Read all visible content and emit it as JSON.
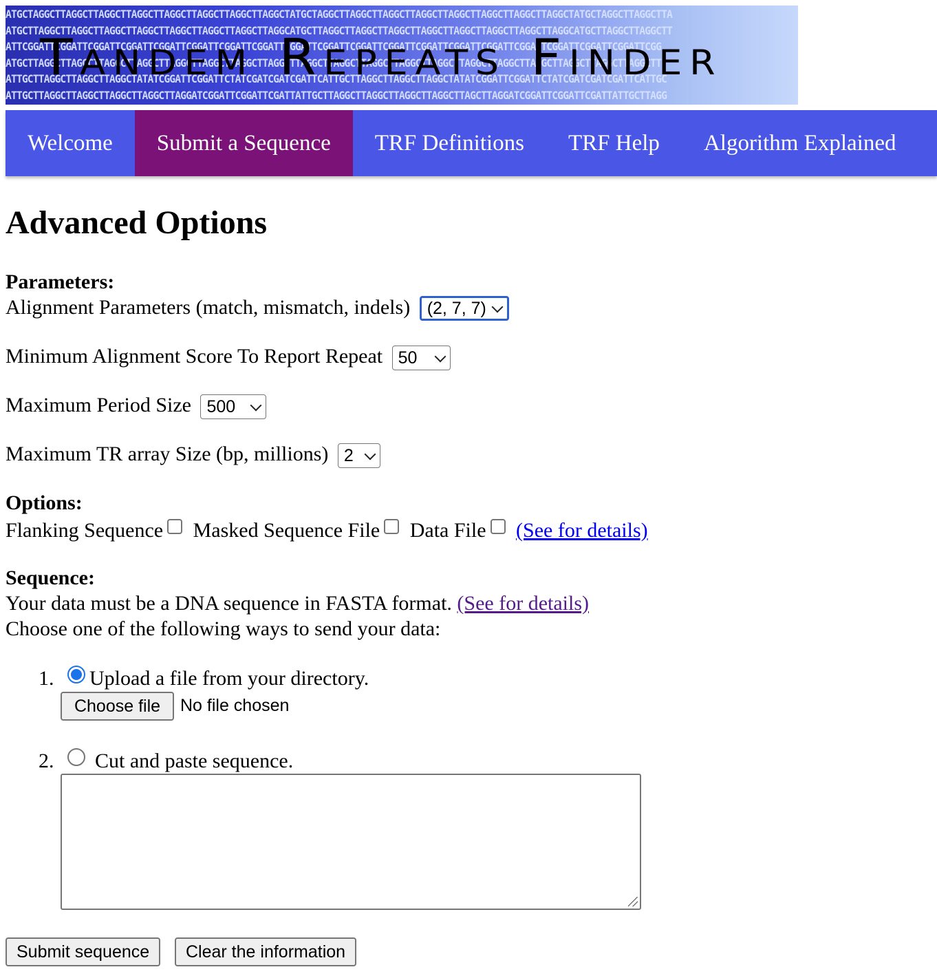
{
  "banner": {
    "title": "Tandem Repeats Finder",
    "dna_rows": [
      "ATGCTAGGCTTAGGCTTAGGCTTAGGCTTAGGCTTAGGCTTAGGCTTAGGCTATGCTAGGCTTAGGCTTAGGCTTAGGCTTAGGCTTAGGCTTAGGCTTAGGCTATGCTAGGCTTAGGCTTA",
      "ATGCTTAGGCTTAGGCTTAGGCTTAGGCTTAGGCTTAGGCTTAGGCTTAGGCATGCTTAGGCTTAGGCTTAGGCTTAGGCTTAGGCTTAGGCTTAGGCTTAGGCATGCTTAGGCTTAGGCTT",
      "ATTCGGATTCGGATTCGGATTCGGATTCGGATTCGGATTCGGATTCGGATTCGGATTCGGATTCGGATTCGGATTCGGATTCGGATTCGGATTCGGATTCGGATTCGGATTCGGATTCGG",
      "ATGCTTAGGCTTAGGCTTAGGCTTAGGCTTAGGCTTAGGCTTAGGCTTAGGCTTAGGCTTAGGCTTAGGCTTAGGCTTAGGCTTAGGCTTAGGCTTAGGCTTAGGCTTAGGCTTAGGCTT",
      "ATTGCTTAGGCTTAGGCTTAGGCTATATCGGATTCGGATTCTATCGATCGATCGATTCATTGCTTAGGCTTAGGCTTAGGCTATATCGGATTCGGATTCTATCGATCGATCGATTCATTGC",
      "ATTGCTTAGGCTTAGGCTTAGGCTTAGGCTTAGGATCGGATTCGGATTCGATTATTGCTTAGGCTTAGGCTTAGGCTTAGGCTTAGCTTAGGATCGGATTCGGATTCGATTATTGCTTAGG"
    ]
  },
  "nav": {
    "items": [
      {
        "label": "Welcome",
        "active": false
      },
      {
        "label": "Submit a Sequence",
        "active": true
      },
      {
        "label": "TRF Definitions",
        "active": false
      },
      {
        "label": "TRF Help",
        "active": false
      },
      {
        "label": "Algorithm Explained",
        "active": false
      }
    ]
  },
  "page": {
    "title": "Advanced Options"
  },
  "parameters": {
    "heading": "Parameters:",
    "alignment": {
      "label": "Alignment Parameters (match, mismatch, indels)",
      "value": "(2, 7, 7)"
    },
    "min_score": {
      "label": "Minimum Alignment Score To Report Repeat",
      "value": "50"
    },
    "max_period": {
      "label": "Maximum Period Size",
      "value": "500"
    },
    "max_tr_array": {
      "label": "Maximum TR array Size (bp, millions)",
      "value": "2"
    }
  },
  "options": {
    "heading": "Options:",
    "flanking_label": "Flanking Sequence",
    "masked_label": "Masked Sequence File",
    "data_file_label": "Data File",
    "details_link": "(See for details)"
  },
  "sequence": {
    "heading": "Sequence:",
    "intro": "Your data must be a DNA sequence in FASTA format.",
    "details_link": "(See for details)",
    "choose_text": "Choose one of the following ways to send your data:",
    "option1_number": "1.",
    "option1_label": "Upload a file from your directory.",
    "choose_file_button": "Choose file",
    "no_file_text": "No file chosen",
    "option2_number": "2.",
    "option2_label": "Cut and paste sequence.",
    "paste_value": ""
  },
  "actions": {
    "submit_label": "Submit sequence",
    "clear_label": "Clear the information"
  },
  "colors": {
    "nav_bg": "#4a56e6",
    "nav_active": "#7a1277",
    "link": "#0000ee",
    "visited_link": "#551a8b",
    "radio_selected": "#1a73e8"
  }
}
